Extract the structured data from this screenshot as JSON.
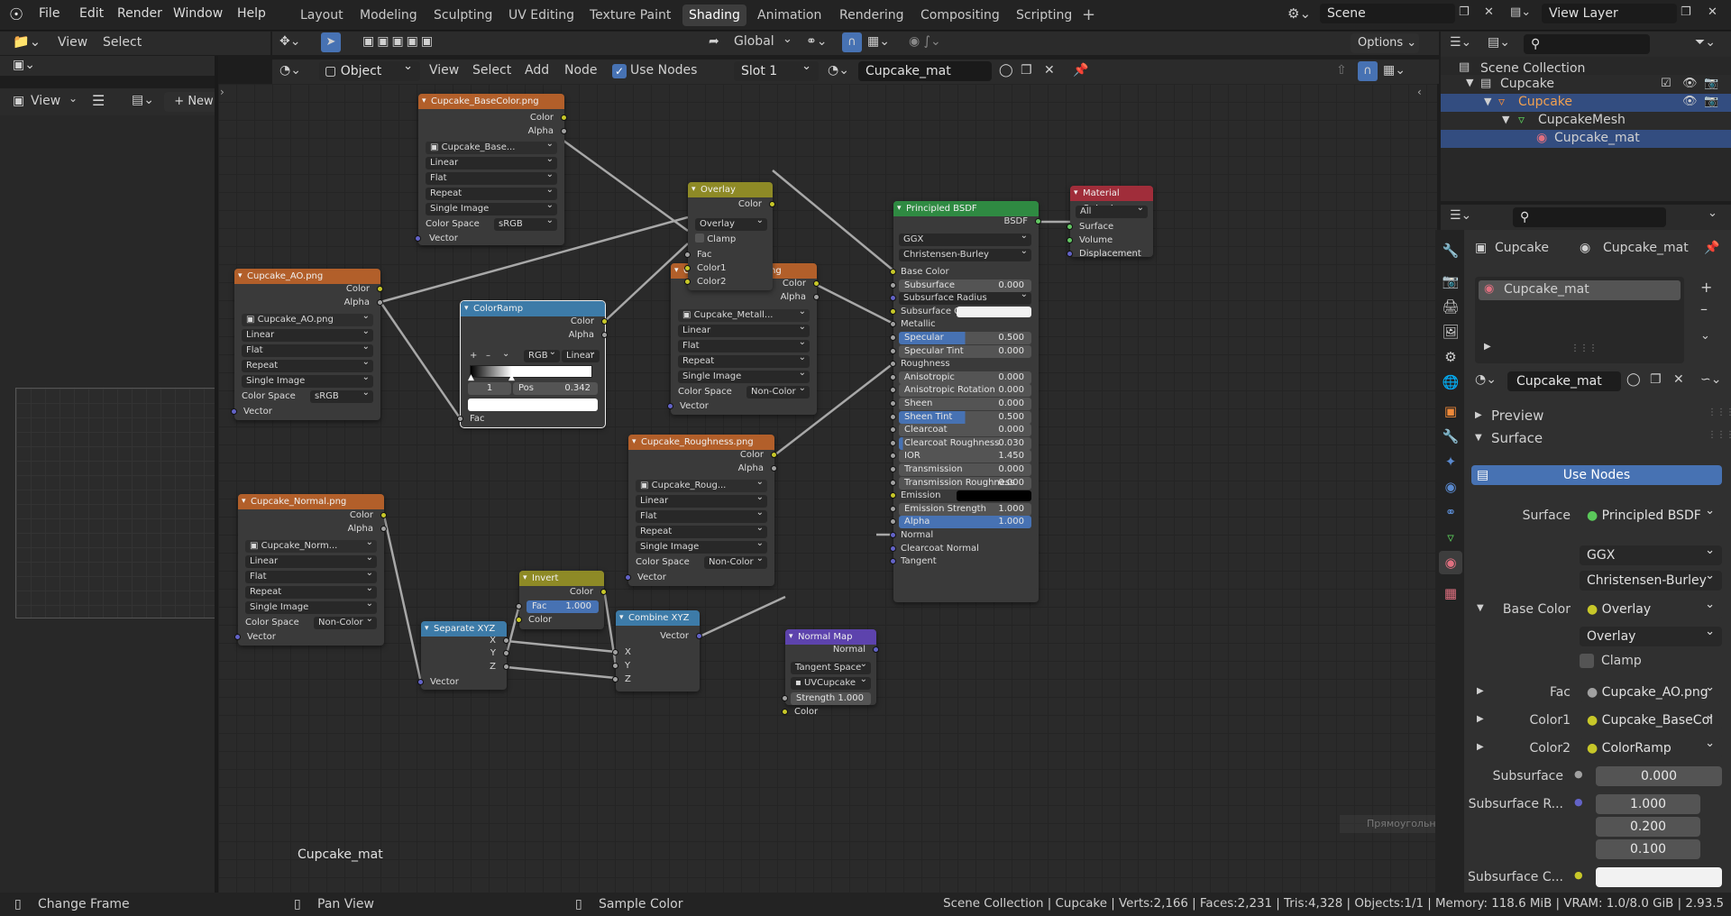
{
  "app": {
    "menus": [
      "File",
      "Edit",
      "Render",
      "Window",
      "Help"
    ],
    "workspaces": [
      "Layout",
      "Modeling",
      "Sculpting",
      "UV Editing",
      "Texture Paint",
      "Shading",
      "Animation",
      "Rendering",
      "Compositing",
      "Scripting"
    ],
    "active_workspace": "Shading",
    "scene_name": "Scene",
    "view_layer_name": "View Layer"
  },
  "image_editor": {
    "view": "View",
    "select": "Select",
    "view2": "View",
    "new": "New"
  },
  "node_header": {
    "global": "Global",
    "options": "Options",
    "object": "Object",
    "view": "View",
    "select": "Select",
    "add": "Add",
    "node": "Node",
    "use_nodes": "Use Nodes",
    "slot": "Slot 1",
    "material": "Cupcake_mat"
  },
  "nodes": {
    "basecolor": {
      "title": "Cupcake_BaseColor.png",
      "out1": "Color",
      "out2": "Alpha",
      "image": "Cupcake_Base...",
      "interp": "Linear",
      "proj": "Flat",
      "ext": "Repeat",
      "src": "Single Image",
      "cs_label": "Color Space",
      "cs": "sRGB",
      "vector": "Vector"
    },
    "ao": {
      "title": "Cupcake_AO.png",
      "out1": "Color",
      "out2": "Alpha",
      "image": "Cupcake_AO.png",
      "interp": "Linear",
      "proj": "Flat",
      "ext": "Repeat",
      "src": "Single Image",
      "cs_label": "Color Space",
      "cs": "sRGB",
      "vector": "Vector"
    },
    "normal": {
      "title": "Cupcake_Normal.png",
      "out1": "Color",
      "out2": "Alpha",
      "image": "Cupcake_Norm...",
      "interp": "Linear",
      "proj": "Flat",
      "ext": "Repeat",
      "src": "Single Image",
      "cs_label": "Color Space",
      "cs": "Non-Color",
      "vector": "Vector"
    },
    "metallic": {
      "title": "Cupcake_Metallic.png",
      "out1": "Color",
      "out2": "Alpha",
      "image": "Cupcake_Metall...",
      "interp": "Linear",
      "proj": "Flat",
      "ext": "Repeat",
      "src": "Single Image",
      "cs_label": "Color Space",
      "cs": "Non-Color",
      "vector": "Vector"
    },
    "roughness": {
      "title": "Cupcake_Roughness.png",
      "out1": "Color",
      "out2": "Alpha",
      "image": "Cupcake_Roug...",
      "interp": "Linear",
      "proj": "Flat",
      "ext": "Repeat",
      "src": "Single Image",
      "cs_label": "Color Space",
      "cs": "Non-Color",
      "vector": "Vector"
    },
    "overlay": {
      "title": "Overlay",
      "out": "Color",
      "mode": "Overlay",
      "clamp": "Clamp",
      "fac": "Fac",
      "c1": "Color1",
      "c2": "Color2"
    },
    "colorramp": {
      "title": "ColorRamp",
      "out1": "Color",
      "out2": "Alpha",
      "mode": "RGB",
      "interp": "Linear",
      "index": "1",
      "pos_label": "Pos",
      "pos": "0.342",
      "fac": "Fac"
    },
    "invert": {
      "title": "Invert",
      "out": "Color",
      "fac_label": "Fac",
      "fac": "1.000",
      "color": "Color"
    },
    "separate": {
      "title": "Separate XYZ",
      "x": "X",
      "y": "Y",
      "z": "Z",
      "vector": "Vector"
    },
    "combine": {
      "title": "Combine XYZ",
      "out": "Vector",
      "x": "X",
      "y": "Y",
      "z": "Z"
    },
    "normalmap": {
      "title": "Normal Map",
      "out": "Normal",
      "space": "Tangent Space",
      "uv": "UVCupcake",
      "strength_label": "Strength",
      "strength": "1.000",
      "color": "Color"
    },
    "bsdf": {
      "title": "Principled BSDF",
      "out": "BSDF",
      "dist": "GGX",
      "sss": "Christensen-Burley",
      "rows": [
        {
          "label": "Base Color",
          "type": "socket"
        },
        {
          "label": "Subsurface",
          "value": "0.000",
          "type": "slider"
        },
        {
          "label": "Subsurface Radius",
          "type": "dropdown"
        },
        {
          "label": "Subsurface C...",
          "type": "color"
        },
        {
          "label": "Metallic",
          "type": "socket"
        },
        {
          "label": "Specular",
          "value": "0.500",
          "type": "slider",
          "fill": 0.5
        },
        {
          "label": "Specular Tint",
          "value": "0.000",
          "type": "slider"
        },
        {
          "label": "Roughness",
          "type": "socket"
        },
        {
          "label": "Anisotropic",
          "value": "0.000",
          "type": "slider"
        },
        {
          "label": "Anisotropic Rotation",
          "value": "0.000",
          "type": "slider"
        },
        {
          "label": "Sheen",
          "value": "0.000",
          "type": "slider"
        },
        {
          "label": "Sheen Tint",
          "value": "0.500",
          "type": "slider",
          "fill": 0.5
        },
        {
          "label": "Clearcoat",
          "value": "0.000",
          "type": "slider"
        },
        {
          "label": "Clearcoat Roughness",
          "value": "0.030",
          "type": "slider",
          "fill": 0.03
        },
        {
          "label": "IOR",
          "value": "1.450",
          "type": "slider"
        },
        {
          "label": "Transmission",
          "value": "0.000",
          "type": "slider"
        },
        {
          "label": "Transmission Roughness",
          "value": "0.000",
          "type": "slider"
        },
        {
          "label": "Emission",
          "type": "emission"
        },
        {
          "label": "Emission Strength",
          "value": "1.000",
          "type": "slider"
        },
        {
          "label": "Alpha",
          "value": "1.000",
          "type": "slider",
          "fill": 1.0
        },
        {
          "label": "Normal",
          "type": "socket"
        },
        {
          "label": "Clearcoat Normal",
          "type": "socket"
        },
        {
          "label": "Tangent",
          "type": "socket"
        }
      ]
    },
    "output": {
      "title": "Material Output",
      "target": "All",
      "surface": "Surface",
      "volume": "Volume",
      "displacement": "Displacement"
    }
  },
  "editor_label": "Cupcake_mat",
  "ghost_tooltip": "Прямоугольник",
  "outliner": {
    "root": "Scene Collection",
    "items": [
      {
        "label": "Cupcake",
        "depth": 1
      },
      {
        "label": "Cupcake",
        "depth": 2
      },
      {
        "label": "CupcakeMesh",
        "depth": 3
      },
      {
        "label": "Cupcake_mat",
        "depth": 4
      }
    ]
  },
  "properties": {
    "object": "Cupcake",
    "material": "Cupcake_mat",
    "slot_item": "Cupcake_mat",
    "mat_field": "Cupcake_mat",
    "preview": "Preview",
    "surface_section": "Surface",
    "use_nodes": "Use Nodes",
    "surface_label": "Surface",
    "surface_value": "Principled BSDF",
    "dist": "GGX",
    "sss": "Christensen-Burley",
    "base_color_label": "Base Color",
    "base_color_value": "Overlay",
    "overlay_mode": "Overlay",
    "clamp": "Clamp",
    "fac_label": "Fac",
    "fac_value": "Cupcake_AO.png",
    "c1_label": "Color1",
    "c1_value": "Cupcake_BaseCol",
    "c2_label": "Color2",
    "c2_value": "ColorRamp",
    "subsurface_label": "Subsurface",
    "subsurface_value": "0.000",
    "ssr_label": "Subsurface R...",
    "ssr_values": [
      "1.000",
      "0.200",
      "0.100"
    ],
    "ssc_label": "Subsurface C..."
  },
  "status": {
    "left": "Change Frame",
    "mid": "Pan View",
    "right": "Sample Color",
    "info": "Scene Collection | Cupcake | Verts:2,166 | Faces:2,231 | Tris:4,328 | Objects:1/1 | Memory: 118.6 MiB | VRAM: 1.0/8.0 GiB | 2.93.5"
  },
  "colors": {
    "accent": "#4772b3",
    "texture_header": "#b25f2a",
    "shader_header": "#2f8a42",
    "output_header": "#a02d3a",
    "converter_header": "#3d7ba8",
    "vector_header": "#5d43ad",
    "mix_header": "#8e8a26"
  }
}
